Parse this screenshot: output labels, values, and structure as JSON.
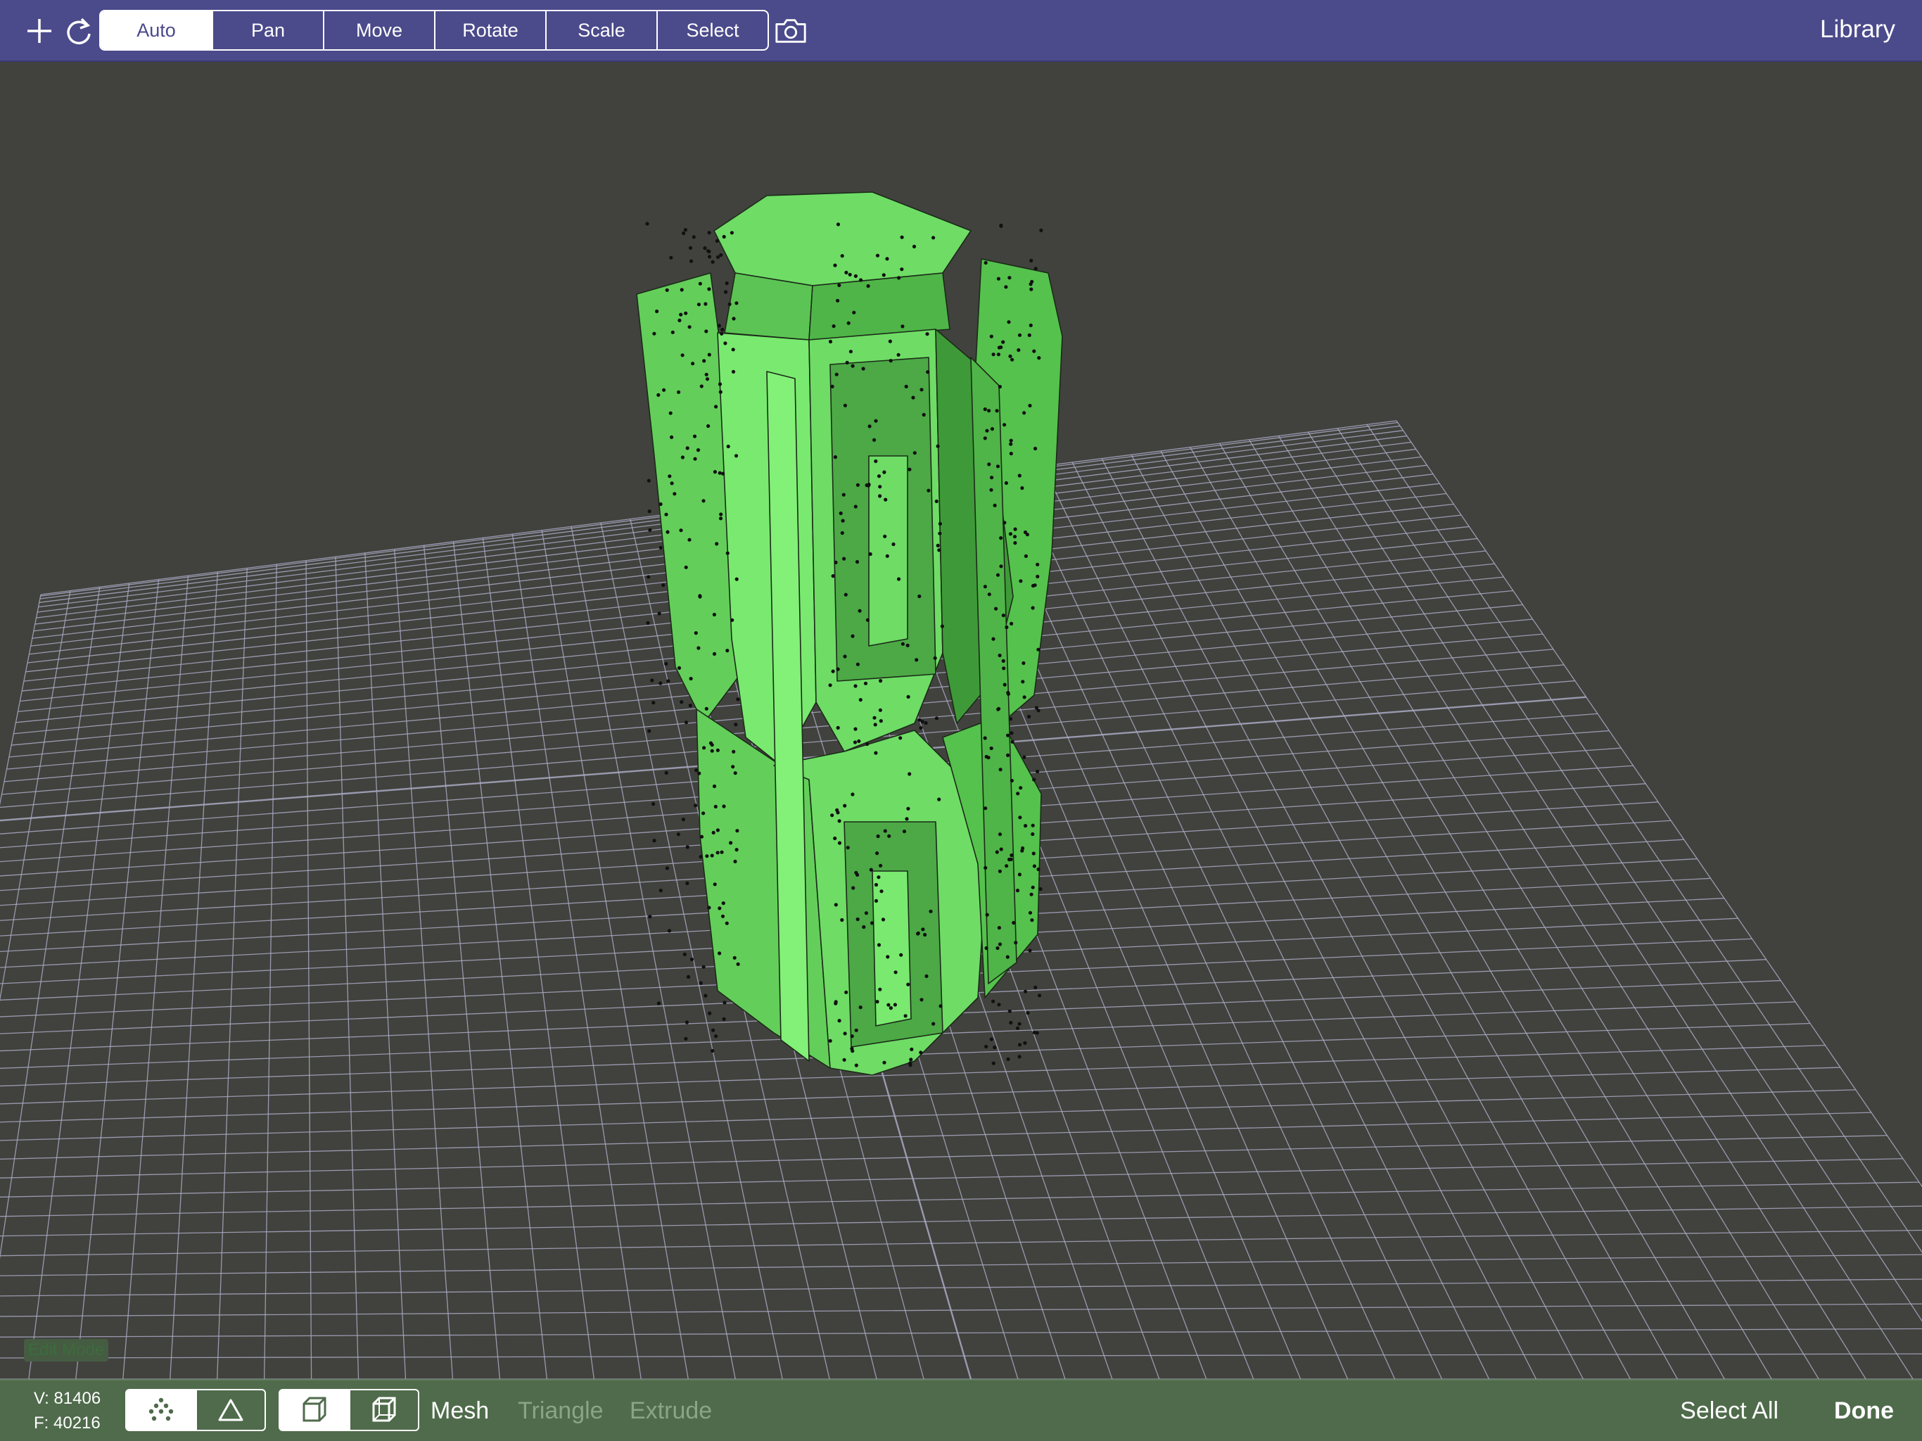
{
  "toolbar": {
    "add_icon": "plus-icon",
    "redo_icon": "redo-icon",
    "modes": [
      "Auto",
      "Pan",
      "Move",
      "Rotate",
      "Scale",
      "Select"
    ],
    "active_mode": "Auto",
    "camera_icon": "camera-icon",
    "library_label": "Library",
    "color": "#4b4a8b"
  },
  "viewport": {
    "background": "#41423d",
    "grid_color": "#a9a9c4",
    "model_color": "#6fdc66",
    "edit_mode_label": "Edit Mode"
  },
  "bottombar": {
    "vertices": "V: 81406",
    "faces": "F: 40216",
    "select_type_icons": [
      "vertex-select-icon",
      "face-select-icon"
    ],
    "select_type_active": "vertex-select-icon",
    "view_icons": [
      "solid-cube-icon",
      "wireframe-cube-icon"
    ],
    "view_active": "solid-cube-icon",
    "mesh_label": "Mesh",
    "triangle_label": "Triangle",
    "extrude_label": "Extrude",
    "select_all_label": "Select All",
    "done_label": "Done",
    "color": "#4f6b4b"
  }
}
